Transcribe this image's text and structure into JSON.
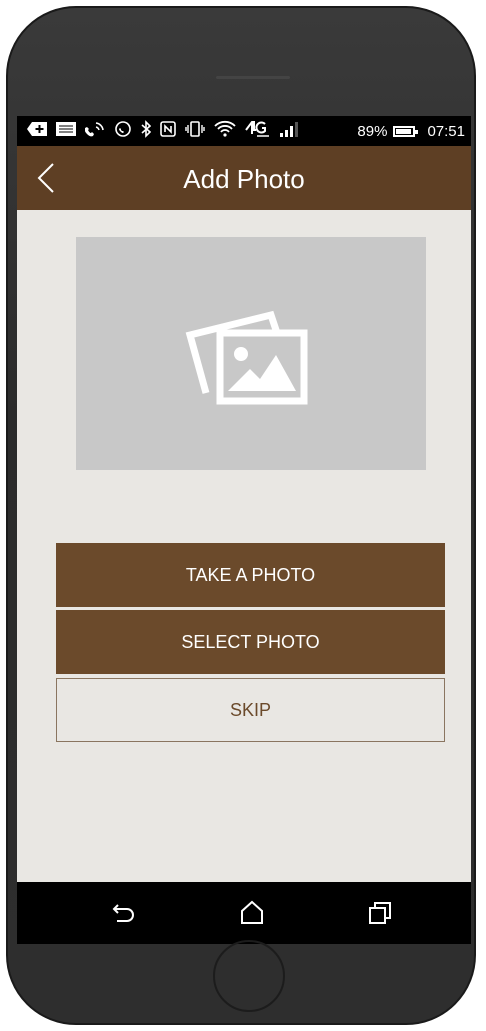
{
  "status_bar": {
    "battery_percent": "89%",
    "battery_level": 0.89,
    "time": "07:51",
    "network": "4G LTE",
    "icons": [
      "add-icon",
      "notification-icon",
      "phone-signal-icon",
      "call-icon",
      "bluetooth-icon",
      "nfc-icon",
      "vibrate-icon",
      "wifi-icon",
      "4g-lte-icon",
      "cell-signal-icon",
      "battery-icon"
    ]
  },
  "app_bar": {
    "title": "Add Photo",
    "back_icon": "chevron-left-icon"
  },
  "photo_placeholder": {
    "icon": "photo-gallery-icon"
  },
  "actions": {
    "take_photo": "TAKE A PHOTO",
    "select_photo": "SELECT PHOTO",
    "skip": "SKIP"
  },
  "nav_bar": {
    "icons": [
      "back-nav-icon",
      "home-nav-icon",
      "recents-nav-icon"
    ]
  },
  "colors": {
    "app_bar": "#5e3f24",
    "button": "#6b4a2b",
    "background": "#e9e7e3",
    "placeholder": "#c8c8c8"
  }
}
